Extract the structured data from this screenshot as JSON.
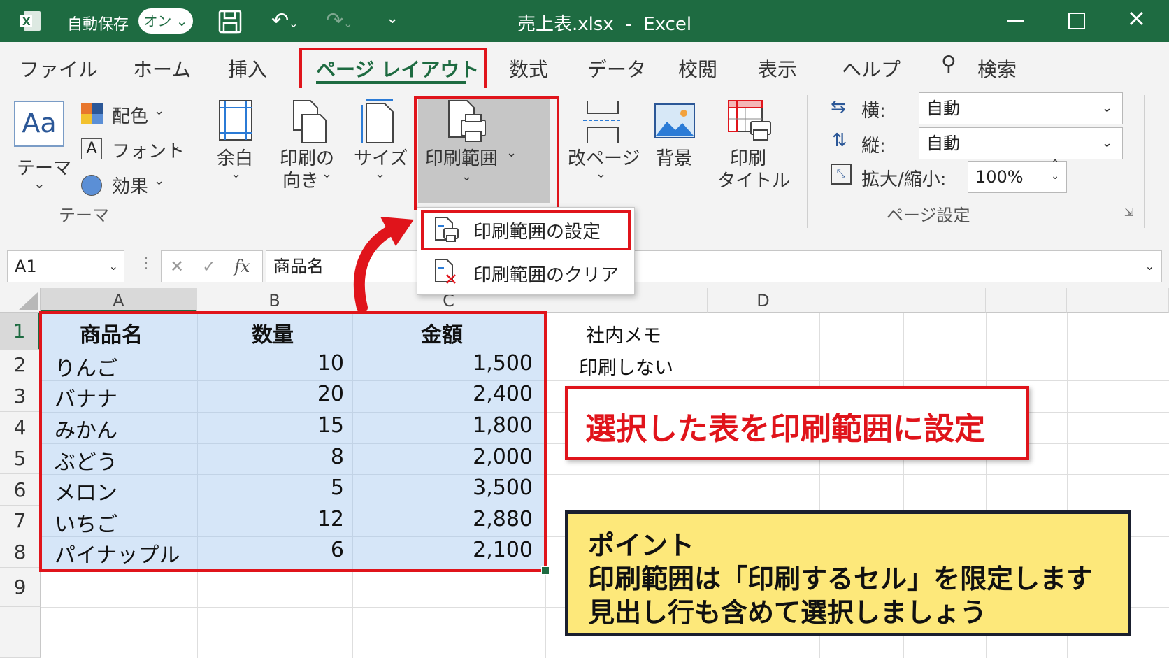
{
  "titlebar": {
    "autosave_label": "自動保存",
    "autosave_state": "オン",
    "title": "売上表.xlsx  -  Excel"
  },
  "tabs": [
    "ファイル",
    "ホーム",
    "挿入",
    "ページ レイアウト",
    "数式",
    "データ",
    "校閲",
    "表示",
    "ヘルプ"
  ],
  "active_tab": "ページ レイアウト",
  "search_label": "検索",
  "ribbon": {
    "theme": {
      "label": "テーマ",
      "colors": "配色",
      "fonts": "フォント",
      "effects": "効果",
      "group": "テーマ"
    },
    "margins": "余白",
    "orientation_line1": "印刷の",
    "orientation_line2": "向き",
    "size": "サイズ",
    "print_area": "印刷範囲",
    "breaks": "改ページ",
    "background": "背景",
    "print_titles_line1": "印刷",
    "print_titles_line2": "タイトル",
    "width_label": "横:",
    "width_value": "自動",
    "height_label": "縦:",
    "height_value": "自動",
    "scale_label": "拡大/縮小:",
    "scale_value": "100%",
    "group_page_setup": "ページ設定"
  },
  "menu": {
    "set": "印刷範囲の設定",
    "clear": "印刷範囲のクリア"
  },
  "formula_bar": {
    "name_box": "A1",
    "fx": "fx",
    "content": "商品名"
  },
  "columns": [
    "A",
    "B",
    "C",
    "D"
  ],
  "rows": [
    "1",
    "2",
    "3",
    "4",
    "5",
    "6",
    "7",
    "8",
    "9"
  ],
  "table": {
    "headers": [
      "商品名",
      "数量",
      "金額"
    ],
    "rows": [
      [
        "りんご",
        "10",
        "1,500"
      ],
      [
        "バナナ",
        "20",
        "2,400"
      ],
      [
        "みかん",
        "15",
        "1,800"
      ],
      [
        "ぶどう",
        "8",
        "2,000"
      ],
      [
        "メロン",
        "5",
        "3,500"
      ],
      [
        "いちご",
        "12",
        "2,880"
      ],
      [
        "パイナップル",
        "6",
        "2,100"
      ]
    ]
  },
  "side_notes": [
    "社内メモ",
    "印刷しない"
  ],
  "callout_main": "選択した表を印刷範囲に設定",
  "point": {
    "title": "ポイント",
    "line1": "印刷範囲は「印刷するセル」を限定します",
    "line2": "見出し行も含めて選択しましょう"
  },
  "colors": {
    "excel_green": "#1e6b41",
    "highlight_red": "#e0141b",
    "selection_blue": "#d6e6f8",
    "note_yellow": "#fde87a"
  }
}
